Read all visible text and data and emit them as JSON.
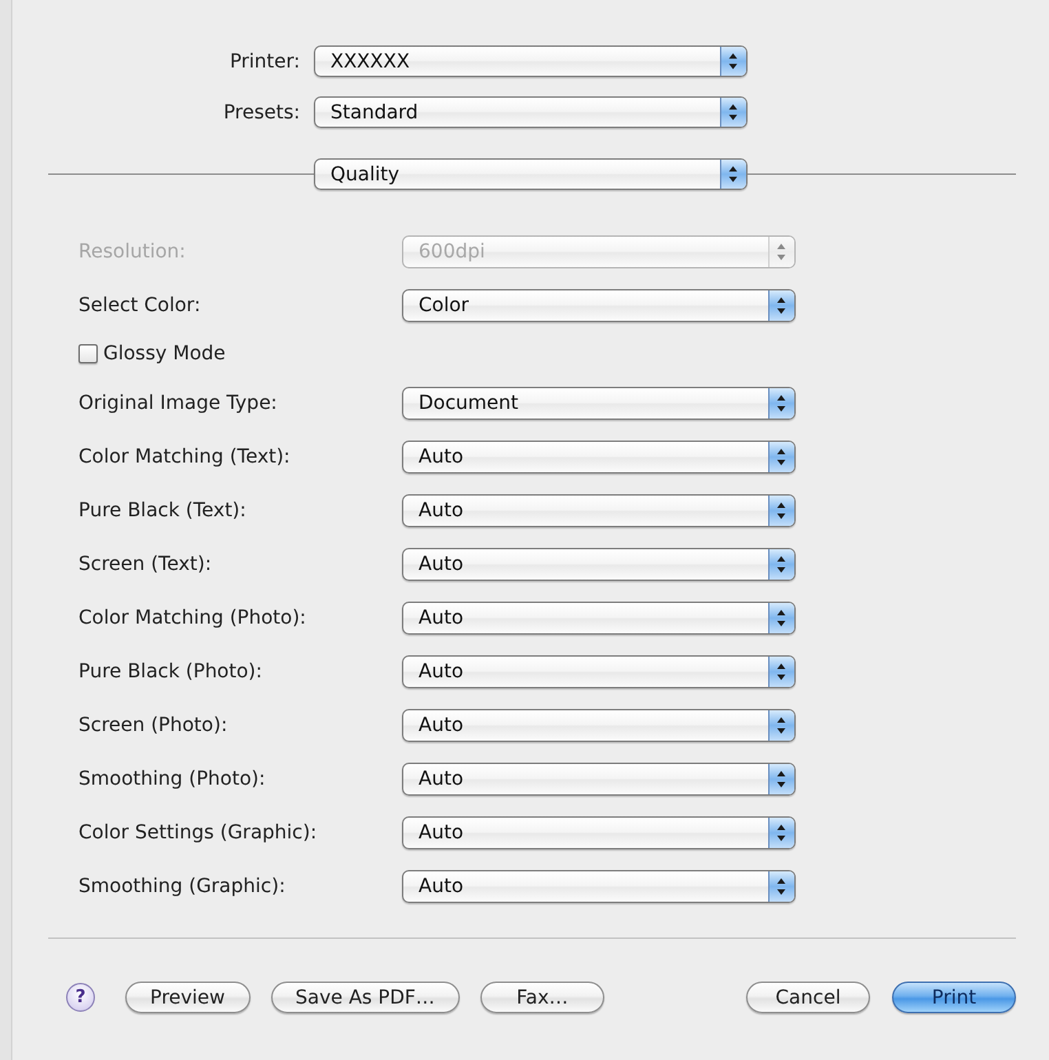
{
  "header": [
    {
      "label": "Printer:",
      "value": "XXXXXX"
    },
    {
      "label": "Presets:",
      "value": "Standard"
    }
  ],
  "panel_menu": {
    "value": "Quality"
  },
  "settings": [
    {
      "kind": "popup",
      "label": "Resolution:",
      "value": "600dpi",
      "disabled": true
    },
    {
      "kind": "popup",
      "label": "Select Color:",
      "value": "Color",
      "disabled": false
    },
    {
      "kind": "checkbox",
      "label": "Glossy Mode",
      "checked": false,
      "disabled": false
    },
    {
      "kind": "popup",
      "label": "Original Image Type:",
      "value": "Document",
      "disabled": false
    },
    {
      "kind": "popup",
      "label": "Color Matching (Text):",
      "value": "Auto",
      "disabled": false
    },
    {
      "kind": "popup",
      "label": "Pure Black (Text):",
      "value": "Auto",
      "disabled": false
    },
    {
      "kind": "popup",
      "label": "Screen (Text):",
      "value": "Auto",
      "disabled": false
    },
    {
      "kind": "popup",
      "label": "Color Matching (Photo):",
      "value": "Auto",
      "disabled": false
    },
    {
      "kind": "popup",
      "label": "Pure Black (Photo):",
      "value": "Auto",
      "disabled": false
    },
    {
      "kind": "popup",
      "label": "Screen (Photo):",
      "value": "Auto",
      "disabled": false
    },
    {
      "kind": "popup",
      "label": "Smoothing (Photo):",
      "value": "Auto",
      "disabled": false
    },
    {
      "kind": "popup",
      "label": "Color Settings (Graphic):",
      "value": "Auto",
      "disabled": false
    },
    {
      "kind": "popup",
      "label": "Smoothing (Graphic):",
      "value": "Auto",
      "disabled": false
    }
  ],
  "help_button": {
    "label": "?"
  },
  "buttons_left": [
    {
      "label": "Preview",
      "default": false
    },
    {
      "label": "Save As PDF…",
      "default": false
    },
    {
      "label": "Fax…",
      "default": false
    }
  ],
  "buttons_right": [
    {
      "label": "Cancel",
      "default": false
    },
    {
      "label": "Print",
      "default": true
    }
  ]
}
